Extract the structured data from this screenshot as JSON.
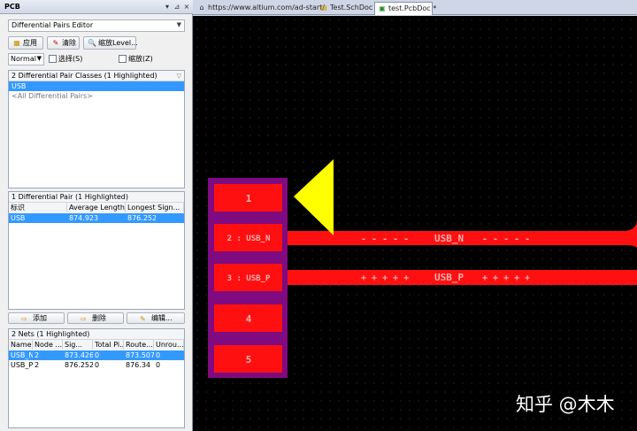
{
  "panel": {
    "title": "PCB",
    "header_buttons": [
      "▾",
      "⊿",
      "×"
    ],
    "mode_combo": "Differential Pairs Editor",
    "toolbar": {
      "apply": "应用",
      "clear": "清除",
      "zoom": "缩放Level..."
    },
    "normal_combo": "Normal",
    "select_label": "选择(S)",
    "zoom_label": "缩放(Z)"
  },
  "classes": {
    "title": "2 Differential Pair Classes (1 Highlighted)",
    "rows": [
      "USB",
      "<All Differential Pairs>"
    ]
  },
  "pairs": {
    "title": "1 Differential Pair (1 Highlighted)",
    "columns": [
      "标识",
      "Average Length...",
      "Longest Sign..."
    ],
    "rows": [
      {
        "name": "USB",
        "avg": "874.923",
        "longest": "876.252"
      }
    ],
    "buttons": {
      "add": "添加",
      "delete": "删除",
      "edit": "编辑..."
    }
  },
  "nets": {
    "title": "2 Nets (1 Highlighted)",
    "columns": [
      "Name",
      "Node ...",
      "Sig...",
      "Total Pi...",
      "Route...",
      "Unrou..."
    ],
    "rows": [
      [
        "USB_N",
        "2",
        "873.426",
        "0",
        "873.507",
        "0"
      ],
      [
        "USB_P",
        "2",
        "876.252",
        "0",
        "876.34",
        "0"
      ]
    ]
  },
  "tabs": [
    {
      "label": "https://www.altium.com/ad-start/",
      "icon": "home-icon"
    },
    {
      "label": "Test.SchDoc *",
      "icon": "schematic-doc-icon"
    },
    {
      "label": "test.PcbDoc *",
      "icon": "pcb-doc-icon"
    }
  ],
  "board": {
    "pads": [
      "1",
      "2 : USB_N",
      "3 : USB_P",
      "4",
      "5"
    ],
    "trace_n_label": "USB_N",
    "trace_n_marks": "- - - - -",
    "trace_n_marks_right": "- - - - -",
    "trace_p_label": "USB_P",
    "trace_p_marks": "+ + + + +",
    "trace_p_marks_right": "+ + + + +",
    "colors": {
      "pad": "#ff1010",
      "component": "#800a80",
      "trace": "#ff1010",
      "arrow": "#ffff00",
      "background": "#000000"
    }
  },
  "watermark": "知乎 @木木"
}
